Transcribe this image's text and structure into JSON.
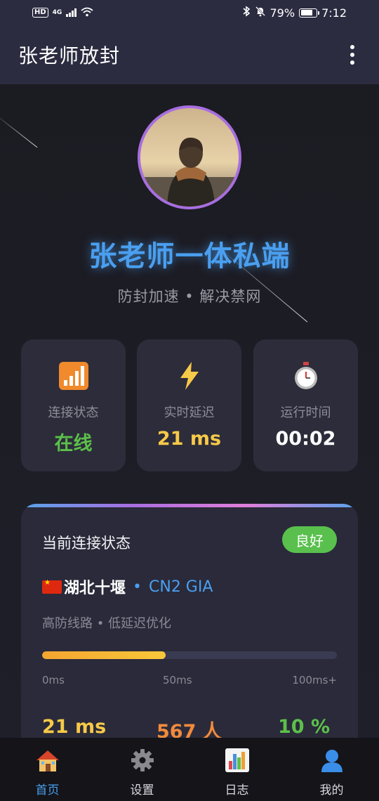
{
  "status_bar": {
    "hd": "HD",
    "network": "4G",
    "battery": "79%",
    "battery_level": 0.79,
    "time": "7:12"
  },
  "app_bar": {
    "title": "张老师放封"
  },
  "hero": {
    "title": "张老师一体私端",
    "subtitle": "防封加速 • 解决禁网"
  },
  "stats": [
    {
      "icon": "signal-bars-icon",
      "label": "连接状态",
      "value": "在线",
      "color": "#5cc04a"
    },
    {
      "icon": "lightning-icon",
      "label": "实时延迟",
      "value": "21 ms",
      "color": "#f7c948"
    },
    {
      "icon": "stopwatch-icon",
      "label": "运行时间",
      "value": "00:02",
      "color": "#ffffff"
    }
  ],
  "connection": {
    "title": "当前连接状态",
    "badge": "良好",
    "location": "湖北十堰",
    "separator": "•",
    "line_type": "CN2 GIA",
    "description": "高防线路 • 低延迟优化",
    "latency_fraction": 0.42,
    "scale_labels": [
      "0ms",
      "50ms",
      "100ms+"
    ],
    "metrics": [
      {
        "value": "21 ms",
        "color": "#f7c948"
      },
      {
        "value": "567 人",
        "color": "#f08a3c"
      },
      {
        "value": "10 %",
        "color": "#5cc04a"
      }
    ]
  },
  "nav": [
    {
      "icon": "house-icon",
      "label": "首页",
      "active": true
    },
    {
      "icon": "gear-icon",
      "label": "设置",
      "active": false
    },
    {
      "icon": "bar-chart-icon",
      "label": "日志",
      "active": false
    },
    {
      "icon": "user-icon",
      "label": "我的",
      "active": false
    }
  ],
  "colors": {
    "accent": "#4a9ff0",
    "avatar_ring": "#a86ee0",
    "good": "#59c04d"
  }
}
